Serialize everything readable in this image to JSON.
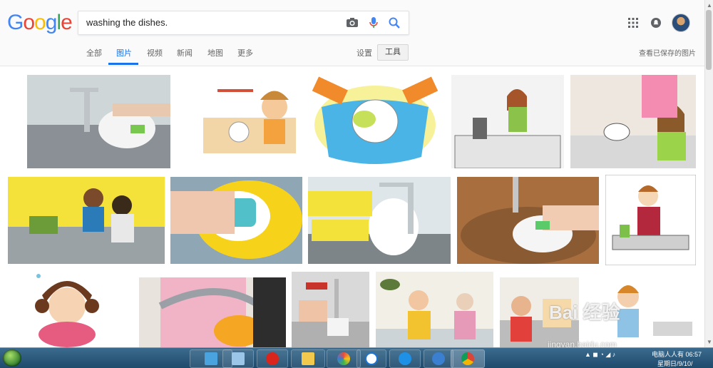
{
  "logo": {
    "letters": [
      "G",
      "o",
      "o",
      "g",
      "l",
      "e"
    ],
    "colors": [
      "#4285f4",
      "#ea4335",
      "#fbbc05",
      "#4285f4",
      "#34a853",
      "#ea4335"
    ]
  },
  "search": {
    "query": "washing the dishes.",
    "icons": [
      "camera-icon",
      "mic-icon",
      "search-icon"
    ]
  },
  "tabs": [
    {
      "label": "全部",
      "active": false
    },
    {
      "label": "图片",
      "active": true
    },
    {
      "label": "视频",
      "active": false
    },
    {
      "label": "新闻",
      "active": false
    },
    {
      "label": "地图",
      "active": false
    },
    {
      "label": "更多",
      "active": false
    }
  ],
  "toolbar": {
    "settings": "设置",
    "tools": "工具",
    "saved_images": "查看已保存的图片"
  },
  "header_icons": [
    "apps-icon",
    "notifications-icon",
    "avatar"
  ],
  "results": [
    {
      "id": "r1",
      "kind": "photo"
    },
    {
      "id": "r2",
      "kind": "clipart"
    },
    {
      "id": "r3",
      "kind": "clipart"
    },
    {
      "id": "r4",
      "kind": "clipart"
    },
    {
      "id": "r5",
      "kind": "clipart"
    },
    {
      "id": "r6",
      "kind": "photo"
    },
    {
      "id": "r7",
      "kind": "photo"
    },
    {
      "id": "r8",
      "kind": "photo"
    },
    {
      "id": "r9",
      "kind": "photo"
    },
    {
      "id": "r10",
      "kind": "clipart"
    },
    {
      "id": "r11",
      "kind": "clipart"
    },
    {
      "id": "r12",
      "kind": "photo"
    },
    {
      "id": "r13",
      "kind": "photo"
    },
    {
      "id": "r14",
      "kind": "clipart"
    },
    {
      "id": "r15",
      "kind": "photo"
    },
    {
      "id": "r16",
      "kind": "clipart"
    }
  ],
  "watermark": {
    "text": "Bai 经验",
    "url": "jingyan.baidu.com"
  },
  "taskbar": {
    "items": [
      "start-button",
      "desktop-icon",
      "computer-icon",
      "chess-icon",
      "folder-icon",
      "paint-icon",
      "sogou-icon",
      "ie-icon",
      "settings-icon",
      "chrome-icon"
    ],
    "tray_text": "电脑人人有",
    "time": "06:57",
    "date": "星期日/9/10/"
  },
  "colors": {
    "accent": "#1a73e8",
    "taskbar": "#2a5a80"
  }
}
